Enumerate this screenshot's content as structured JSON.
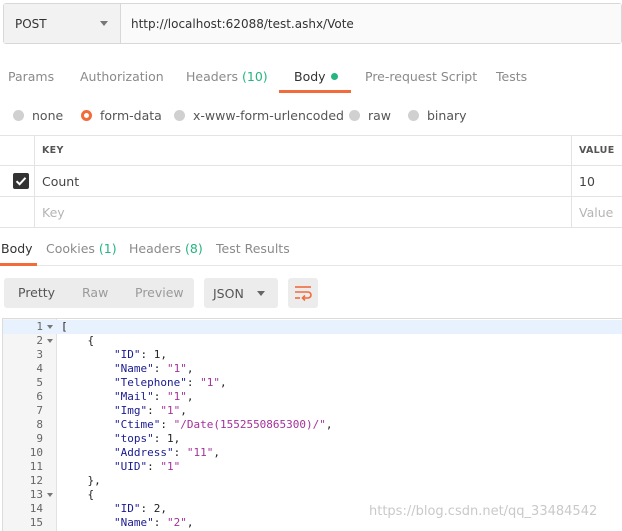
{
  "request": {
    "method": "POST",
    "url": "http://localhost:62088/test.ashx/Vote"
  },
  "request_tabs": [
    {
      "label": "Params",
      "count": ""
    },
    {
      "label": "Authorization",
      "count": ""
    },
    {
      "label": "Headers ",
      "count": "(10)"
    },
    {
      "label": "Body",
      "count": ""
    },
    {
      "label": "Pre-request Script",
      "count": ""
    },
    {
      "label": "Tests",
      "count": ""
    }
  ],
  "body_types": [
    "none",
    "form-data",
    "x-www-form-urlencoded",
    "raw",
    "binary"
  ],
  "selected_body_type": "form-data",
  "kv_table": {
    "headers": {
      "key": "KEY",
      "value": "VALUE"
    },
    "rows": [
      {
        "checked": true,
        "key": "Count",
        "value": "10"
      }
    ],
    "placeholder": {
      "key": "Key",
      "value": "Value"
    }
  },
  "response_tabs": [
    {
      "label": "Body",
      "count": ""
    },
    {
      "label": "Cookies ",
      "count": "(1)"
    },
    {
      "label": "Headers ",
      "count": "(8)"
    },
    {
      "label": "Test Results",
      "count": ""
    }
  ],
  "view_modes": [
    "Pretty",
    "Raw",
    "Preview"
  ],
  "active_view": "Pretty",
  "format": "JSON",
  "code_lines": [
    {
      "n": "1",
      "fold": true,
      "text": "["
    },
    {
      "n": "2",
      "fold": true,
      "text": "    {"
    },
    {
      "n": "3",
      "fold": false,
      "text": "        \"ID\": 1,"
    },
    {
      "n": "4",
      "fold": false,
      "text": "        \"Name\": \"1\","
    },
    {
      "n": "5",
      "fold": false,
      "text": "        \"Telephone\": \"1\","
    },
    {
      "n": "6",
      "fold": false,
      "text": "        \"Mail\": \"1\","
    },
    {
      "n": "7",
      "fold": false,
      "text": "        \"Img\": \"1\","
    },
    {
      "n": "8",
      "fold": false,
      "text": "        \"Ctime\": \"/Date(1552550865300)/\","
    },
    {
      "n": "9",
      "fold": false,
      "text": "        \"tops\": 1,"
    },
    {
      "n": "10",
      "fold": false,
      "text": "        \"Address\": \"11\","
    },
    {
      "n": "11",
      "fold": false,
      "text": "        \"UID\": \"1\""
    },
    {
      "n": "12",
      "fold": false,
      "text": "    },"
    },
    {
      "n": "13",
      "fold": true,
      "text": "    {"
    },
    {
      "n": "14",
      "fold": false,
      "text": "        \"ID\": 2,"
    },
    {
      "n": "15",
      "fold": false,
      "text": "        \"Name\": \"2\","
    }
  ],
  "watermark": "https://blog.csdn.net/qq_33484542",
  "colors": {
    "accent": "#f26b3a",
    "count": "#26b47f"
  }
}
